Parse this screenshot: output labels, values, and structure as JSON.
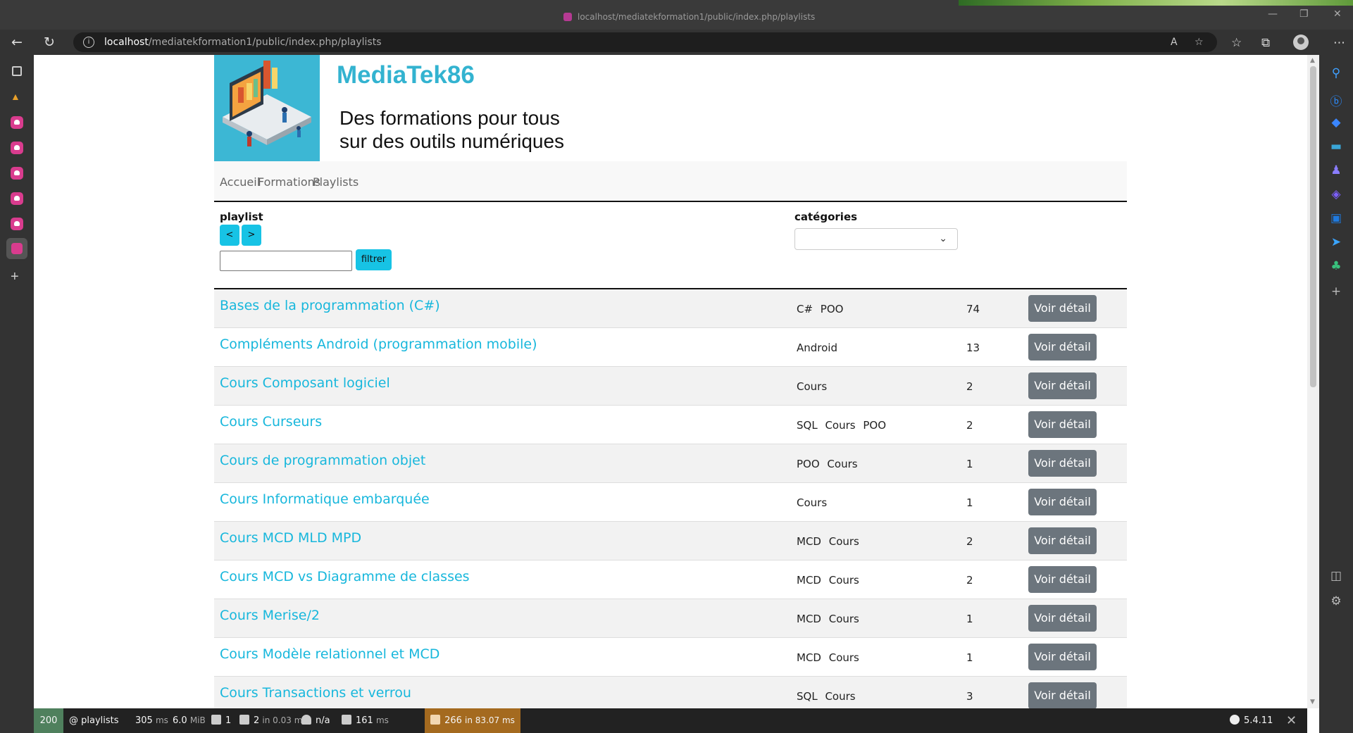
{
  "browser": {
    "tab_title": "localhost/mediatekformation1/public/index.php/playlists",
    "url_host": "localhost",
    "url_path": "/mediatekformation1/public/index.php/playlists"
  },
  "site": {
    "title": "MediaTek86",
    "tagline_line1": "Des formations pour tous",
    "tagline_line2": "sur des outils numériques"
  },
  "nav": {
    "home": "Accueil",
    "formations": "Formations",
    "playlists": "Playlists"
  },
  "filters": {
    "playlist_label": "playlist",
    "sort_asc": "<",
    "sort_desc": ">",
    "filter_value": "",
    "filter_button": "filtrer",
    "categories_label": "catégories",
    "categories_selected": ""
  },
  "playlists": [
    {
      "name": "Bases de la programmation (C#)",
      "categories": "C# POO",
      "count": "74",
      "action": "Voir détail"
    },
    {
      "name": "Compléments Android (programmation mobile)",
      "categories": "Android",
      "count": "13",
      "action": "Voir détail"
    },
    {
      "name": "Cours Composant logiciel",
      "categories": "Cours",
      "count": "2",
      "action": "Voir détail"
    },
    {
      "name": "Cours Curseurs",
      "categories": "SQL Cours POO",
      "count": "2",
      "action": "Voir détail"
    },
    {
      "name": "Cours de programmation objet",
      "categories": "POO Cours",
      "count": "1",
      "action": "Voir détail"
    },
    {
      "name": "Cours Informatique embarquée",
      "categories": "Cours",
      "count": "1",
      "action": "Voir détail"
    },
    {
      "name": "Cours MCD MLD MPD",
      "categories": "MCD Cours",
      "count": "2",
      "action": "Voir détail"
    },
    {
      "name": "Cours MCD vs Diagramme de classes",
      "categories": "MCD Cours",
      "count": "2",
      "action": "Voir détail"
    },
    {
      "name": "Cours Merise/2",
      "categories": "MCD Cours",
      "count": "1",
      "action": "Voir détail"
    },
    {
      "name": "Cours Modèle relationnel et MCD",
      "categories": "MCD Cours",
      "count": "1",
      "action": "Voir détail"
    },
    {
      "name": "Cours Transactions et verrou",
      "categories": "SQL Cours",
      "count": "3",
      "action": "Voir détail"
    }
  ],
  "debug_toolbar": {
    "status": "200",
    "route": "@ playlists",
    "time": "305",
    "time_unit": "ms",
    "memory": "6.0",
    "memory_unit": "MiB",
    "logs": "1",
    "cache": "2",
    "cache_detail": "in 0.03 ms",
    "user": "n/a",
    "twig_time": "161",
    "twig_unit": "ms",
    "db_queries": "266",
    "db_detail": "in 83.07 ms",
    "symfony_version": "5.4.11"
  },
  "colors": {
    "accent": "#17c3e5",
    "title": "#33b3d0",
    "button_gray": "#6c757d",
    "status_ok": "#4f805d",
    "db_warning": "#a46a1f"
  }
}
